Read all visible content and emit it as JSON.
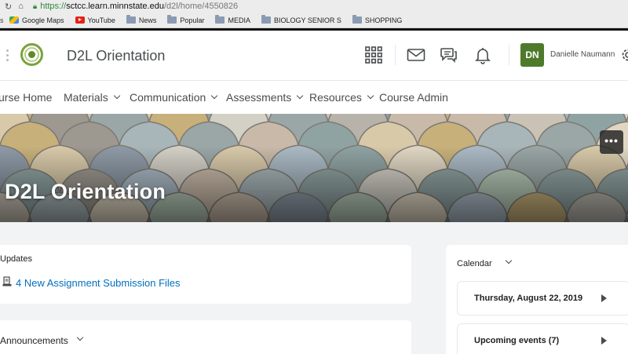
{
  "browser": {
    "url_scheme": "https://",
    "url_host": "sctcc.learn.minnstate.edu",
    "url_path": "/d2l/home/4550826",
    "bookmarks": [
      {
        "label": "Google Maps",
        "icon": "google-maps-icon"
      },
      {
        "label": "YouTube",
        "icon": "youtube-icon"
      },
      {
        "label": "News",
        "icon": "folder-icon"
      },
      {
        "label": "Popular",
        "icon": "folder-icon"
      },
      {
        "label": "MEDIA",
        "icon": "folder-icon"
      },
      {
        "label": "BIOLOGY SENIOR S",
        "icon": "folder-icon"
      },
      {
        "label": "SHOPPING",
        "icon": "folder-icon"
      }
    ]
  },
  "header": {
    "org_name": "D2L Orientation",
    "user_initials": "DN",
    "user_name": "Danielle Naumann",
    "avatar_color": "#4e7a2b"
  },
  "nav": {
    "items": [
      {
        "label": "urse Home"
      },
      {
        "label": "Materials"
      },
      {
        "label": "Communication"
      },
      {
        "label": "Assessments"
      },
      {
        "label": "Resources"
      },
      {
        "label": "Course Admin"
      }
    ]
  },
  "banner": {
    "title": "D2L Orientation",
    "more_label": "•••"
  },
  "widgets": {
    "updates": {
      "title": "Updates",
      "link": "4 New Assignment Submission Files"
    },
    "announcements": {
      "title": "Announcements"
    },
    "calendar": {
      "title": "Calendar",
      "date": "Thursday, August 22, 2019",
      "upcoming": "Upcoming events (7)"
    }
  },
  "colors": {
    "link": "#006fbf",
    "text": "#494c4e"
  }
}
